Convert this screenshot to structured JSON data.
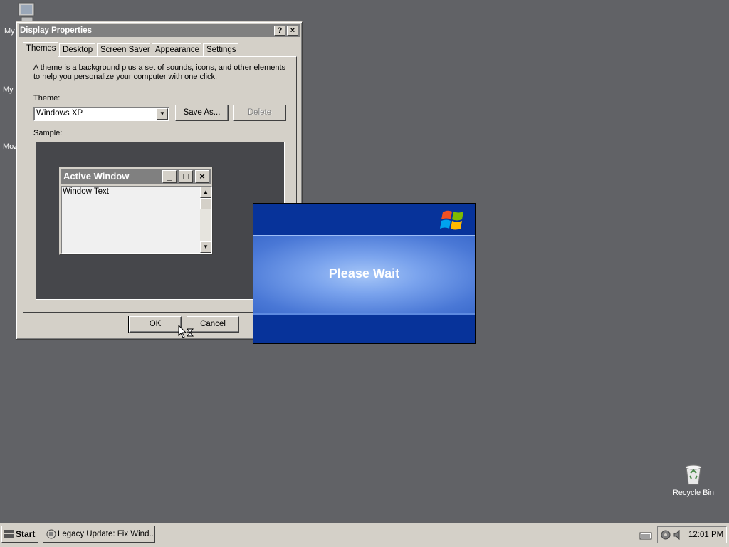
{
  "desktop": {
    "icons": [
      {
        "label": "My",
        "icon": "my-computer-icon"
      },
      {
        "label": "My I",
        "icon": "my-documents-icon"
      },
      {
        "label": "Moz",
        "icon": "mozilla-icon"
      }
    ],
    "recycle_bin": {
      "label": "Recycle Bin",
      "icon": "recycle-bin-icon"
    }
  },
  "dialog": {
    "title": "Display Properties",
    "title_buttons": {
      "help": "?",
      "close": "×"
    },
    "tabs": [
      "Themes",
      "Desktop",
      "Screen Saver",
      "Appearance",
      "Settings"
    ],
    "active_tab": "Themes",
    "description": "A theme is a background plus a set of sounds, icons, and other elements to help you personalize your computer with one click.",
    "theme_label": "Theme:",
    "theme_value": "Windows XP",
    "save_as_label": "Save As...",
    "delete_label": "Delete",
    "sample_label": "Sample:",
    "sample": {
      "window_title": "Active Window",
      "window_text": "Window Text"
    },
    "ok_label": "OK",
    "cancel_label": "Cancel"
  },
  "please_wait": {
    "text": "Please Wait"
  },
  "taskbar": {
    "start_label": "Start",
    "task_label": "Legacy Update: Fix Wind...",
    "clock": "12:01 PM"
  },
  "colors": {
    "desktop": "#616266",
    "dialog_face": "#d4d0c8",
    "title_inactive": "#808080",
    "wait_blue": "#07339a"
  }
}
